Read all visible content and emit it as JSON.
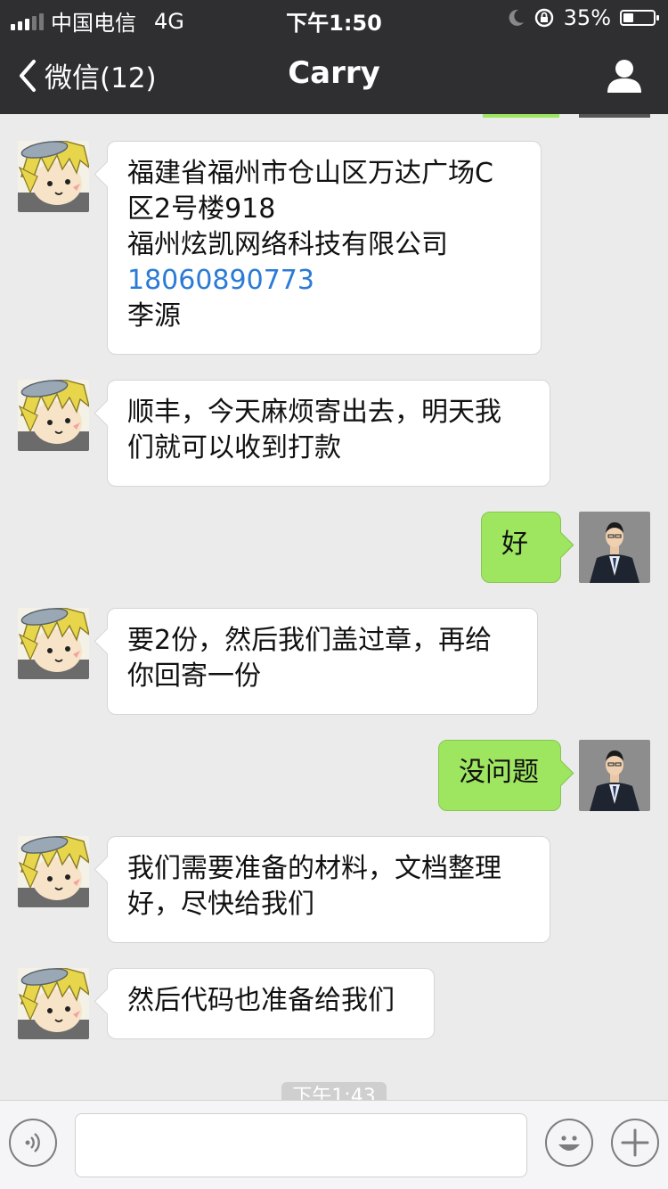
{
  "status_bar": {
    "carrier": "中国电信",
    "network": "4G",
    "time": "下午1:50",
    "battery": "35%",
    "battery_level": 0.35
  },
  "nav": {
    "back_label": "微信(12)",
    "title": "Carry",
    "back_icon": "chevron-left-icon",
    "profile_icon": "person-icon"
  },
  "messages": [
    {
      "from": "them",
      "lines": [
        "福建省福州市仓山区万达广场C",
        "区2号楼918",
        "福州炫凯网络科技有限公司"
      ],
      "phone": "18060890773",
      "trailer": "李源"
    },
    {
      "from": "them",
      "lines": [
        "顺丰，今天麻烦寄出去，明天我",
        "们就可以收到打款"
      ]
    },
    {
      "from": "me",
      "lines": [
        "好"
      ]
    },
    {
      "from": "them",
      "lines": [
        "要2份，然后我们盖过章，再给",
        "你回寄一份"
      ]
    },
    {
      "from": "me",
      "lines": [
        "没问题"
      ]
    },
    {
      "from": "them",
      "lines": [
        "我们需要准备的材料，文档整理",
        "好，尽快给我们"
      ]
    },
    {
      "from": "them",
      "lines": [
        "然后代码也准备给我们"
      ]
    }
  ],
  "timestamp": "下午1:43",
  "input_bar": {
    "text": "",
    "voice_icon": "voice-icon",
    "emoji_icon": "emoji-icon",
    "plus_icon": "plus-icon"
  },
  "colors": {
    "nav_bg": "#2f2f31",
    "chat_bg": "#ebebeb",
    "outgoing_bubble": "#9ee660",
    "incoming_bubble": "#ffffff",
    "link": "#2b7bd6"
  }
}
